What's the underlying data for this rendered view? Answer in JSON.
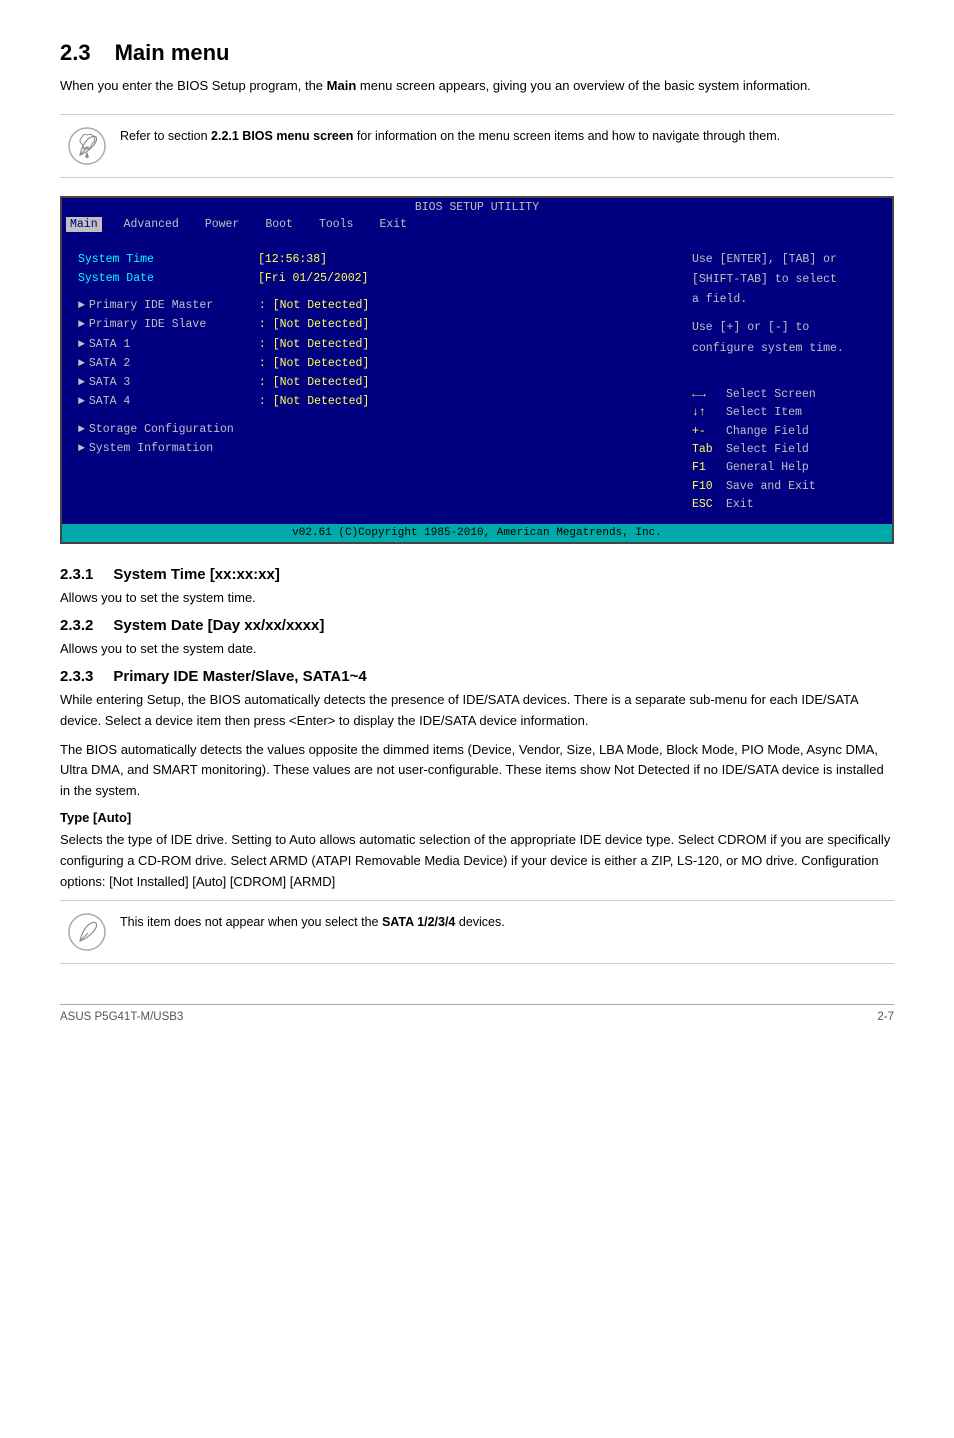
{
  "page": {
    "section": "2.3",
    "title": "Main menu",
    "intro": "When you enter the BIOS Setup program, the Main menu screen appears, giving you an overview of the basic system information.",
    "note1": {
      "text": "Refer to section 2.2.1 BIOS menu screen for information on the menu screen items and how to navigate through them."
    },
    "bios": {
      "title": "BIOS SETUP UTILITY",
      "menu_items": [
        "Main",
        "Advanced",
        "Power",
        "Boot",
        "Tools",
        "Exit"
      ],
      "active_menu": "Main",
      "left_panel": {
        "system_time_label": "System Time",
        "system_time_value": "[12:56:38]",
        "system_date_label": "System Date",
        "system_date_value": "[Fri 01/25/2002]",
        "devices": [
          {
            "label": "Primary IDE Master",
            "value": ": [Not Detected]"
          },
          {
            "label": "Primary IDE Slave",
            "value": ": [Not Detected]"
          },
          {
            "label": "SATA 1",
            "value": ": [Not Detected]"
          },
          {
            "label": "SATA 2",
            "value": ": [Not Detected]"
          },
          {
            "label": "SATA 3",
            "value": ": [Not Detected]"
          },
          {
            "label": "SATA 4",
            "value": ": [Not Detected]"
          }
        ],
        "sub_items": [
          "Storage Configuration",
          "System Information"
        ]
      },
      "right_panel": {
        "help_lines": [
          "Use [ENTER], [TAB] or",
          "[SHIFT-TAB] to select",
          "a field.",
          "",
          "Use [+] or [-] to",
          "configure system time."
        ],
        "nav": [
          {
            "key": "←→",
            "desc": "Select Screen"
          },
          {
            "key": "↓↑",
            "desc": "Select Item"
          },
          {
            "key": "+-",
            "desc": "Change Field"
          },
          {
            "key": "Tab",
            "desc": "Select Field"
          },
          {
            "key": "F1",
            "desc": "General Help"
          },
          {
            "key": "F10",
            "desc": "Save and Exit"
          },
          {
            "key": "ESC",
            "desc": "Exit"
          }
        ]
      },
      "footer": "v02.61 (C)Copyright 1985-2010, American Megatrends, Inc."
    },
    "sub231": {
      "number": "2.3.1",
      "title": "System Time [xx:xx:xx]",
      "body": "Allows you to set the system time."
    },
    "sub232": {
      "number": "2.3.2",
      "title": "System Date [Day xx/xx/xxxx]",
      "body": "Allows you to set the system date."
    },
    "sub233": {
      "number": "2.3.3",
      "title": "Primary IDE Master/Slave, SATA1~4",
      "body1": "While entering Setup, the BIOS automatically detects the presence of IDE/SATA devices. There is a separate sub-menu for each IDE/SATA device. Select a device item then press <Enter> to display the IDE/SATA device information.",
      "body2": "The BIOS automatically detects the values opposite the dimmed items (Device, Vendor, Size, LBA Mode, Block Mode, PIO Mode, Async DMA, Ultra DMA, and SMART monitoring). These values are not user-configurable. These items show Not Detected if no IDE/SATA device is installed in the system.",
      "type_auto": {
        "heading": "Type [Auto]",
        "body": "Selects the type of IDE drive. Setting to Auto allows automatic selection of the appropriate IDE device type. Select CDROM if you are specifically configuring a CD-ROM drive. Select ARMD (ATAPI Removable Media Device) if your device is either a ZIP, LS-120, or MO drive. Configuration options: [Not Installed] [Auto] [CDROM] [ARMD]"
      },
      "note2": "This item does not appear when you select the SATA 1/2/3/4 devices."
    },
    "footer": {
      "left": "ASUS P5G41T-M/USB3",
      "right": "2-7"
    }
  }
}
